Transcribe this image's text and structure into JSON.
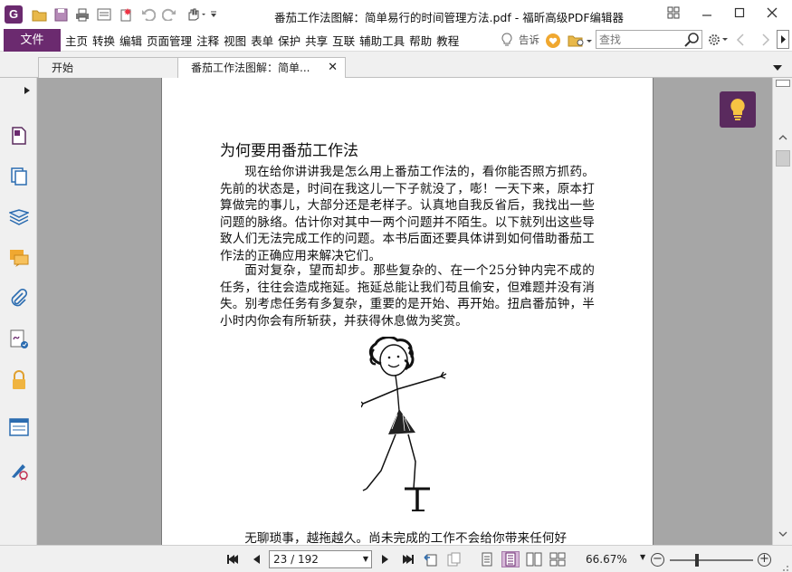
{
  "window": {
    "title": "番茄工作法图解：简单易行的时间管理方法.pdf - 福昕高级PDF编辑器",
    "logo_letter": "G"
  },
  "menu": {
    "file": "文件",
    "items": [
      "主页",
      "转换",
      "编辑",
      "页面管理",
      "注释",
      "视图",
      "表单",
      "保护",
      "共享",
      "互联",
      "辅助工具",
      "帮助",
      "教程"
    ],
    "tell_me": "告诉",
    "search_placeholder": "查找"
  },
  "tabs": [
    {
      "label": "开始"
    },
    {
      "label": "番茄工作法图解：简单..."
    }
  ],
  "document": {
    "heading": "为何要用番茄工作法",
    "paragraphs": [
      "现在给你讲讲我是怎么用上番茄工作法的，看你能否照方抓药。先前的状态是，时间在我这儿一下子就没了，嘭！一天下来，原本打算做完的事儿，大部分还是老样子。认真地自我反省后，我找出一些问题的脉络。估计你对其中一两个问题并不陌生。以下就列出这些导致人们无法完成工作的问题。本书后面还要具体讲到如何借助番茄工作法的正确应用来解决它们。",
      "面对复杂，望而却步。那些复杂的、在一个25分钟内完不成的任务，往往会造成拖延。拖延总能让我们苟且偷安，但难题并没有消失。别考虑任务有多复杂，重要的是开始、再开始。扭启番茄钟，半小时内你会有所斩获，并获得休息做为奖赏。",
      "无聊琐事，越拖越久。尚未完成的工作不会给你带来任何好"
    ]
  },
  "status": {
    "page_indicator": "23 / 192",
    "zoom": "66.67%",
    "zoom_fraction": 0.33
  },
  "colors": {
    "brand": "#6b2a6f",
    "hint_button": "#5a2a5e",
    "active_view": "#d6b8d8"
  },
  "icons": {
    "sidebar": [
      "page-thumbnail-icon",
      "pages-icon",
      "layers-icon",
      "comments-icon",
      "attachments-icon",
      "signature-icon",
      "security-lock-icon",
      "form-fields-icon",
      "sign-certificate-icon"
    ]
  }
}
